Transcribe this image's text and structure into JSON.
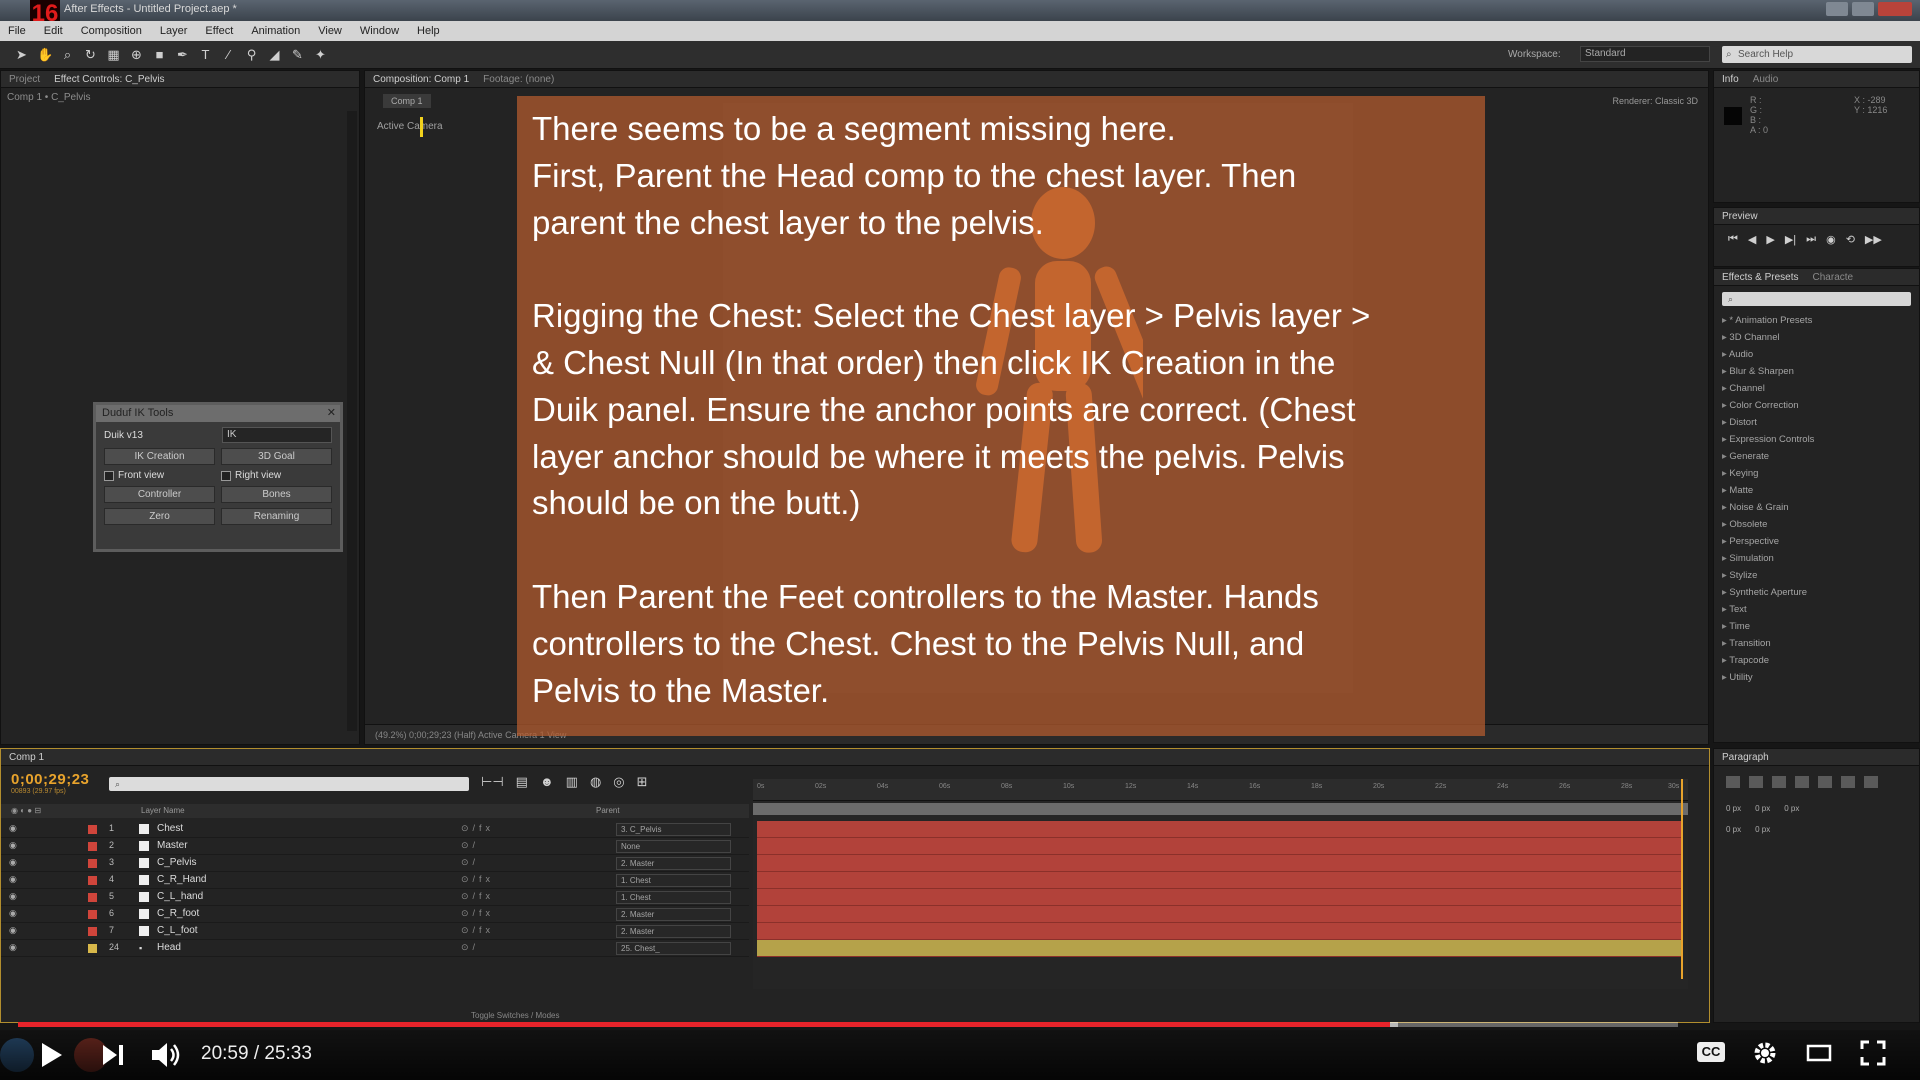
{
  "titlebar": {
    "badge": "16",
    "title": "After Effects - Untitled Project.aep *"
  },
  "menu": [
    "File",
    "Edit",
    "Composition",
    "Layer",
    "Effect",
    "Animation",
    "View",
    "Window",
    "Help"
  ],
  "toolbar": {
    "workspace_label": "Workspace:",
    "workspace_value": "Standard",
    "search_placeholder": "Search Help"
  },
  "left_panel": {
    "tabs": [
      "Project",
      "Effect Controls: C_Pelvis"
    ],
    "breadcrumb": "Comp 1 • C_Pelvis"
  },
  "duik": {
    "title": "Duduf IK Tools",
    "version": "Duik v13",
    "mode": "IK",
    "buttons": [
      "IK Creation",
      "3D Goal",
      "Controller",
      "Bones",
      "Zero",
      "Renaming"
    ],
    "front_view": "Front view",
    "right_view": "Right view"
  },
  "comp_panel": {
    "tabs": [
      "Composition: Comp 1",
      "Footage: (none)"
    ],
    "subtab": "Comp 1",
    "renderer": "Renderer:   Classic 3D",
    "active_camera": "Active Camera",
    "status": "(49.2%)        0;00;29;23                    (Half)              Active Camera        1 View"
  },
  "info_panel": {
    "tabs": [
      "Info",
      "Audio"
    ],
    "rgb": "R :\nG :\nB :\nA : 0",
    "xy": "X : -289\nY : 1216"
  },
  "preview_panel": {
    "tabs": [
      "Preview"
    ]
  },
  "effects_panel": {
    "tabs": [
      "Effects & Presets",
      "Characte"
    ],
    "items": [
      "* Animation Presets",
      "3D Channel",
      "Audio",
      "Blur & Sharpen",
      "Channel",
      "Color Correction",
      "Distort",
      "Expression Controls",
      "Generate",
      "Keying",
      "Matte",
      "Noise & Grain",
      "Obsolete",
      "Perspective",
      "Simulation",
      "Stylize",
      "Synthetic Aperture",
      "Text",
      "Time",
      "Transition",
      "Trapcode",
      "Utility"
    ]
  },
  "para_panel": {
    "tabs": [
      "Paragraph"
    ],
    "indent": [
      "0 px",
      "0 px",
      "0 px",
      "0 px",
      "0 px"
    ]
  },
  "timeline": {
    "tab": "Comp 1",
    "timecode": "0;00;29;23",
    "fps": "00893 (29.97 fps)",
    "columns": {
      "layer": "Layer Name",
      "parent": "Parent"
    },
    "ruler": [
      "0s",
      "02s",
      "04s",
      "06s",
      "08s",
      "10s",
      "12s",
      "14s",
      "16s",
      "18s",
      "20s",
      "22s",
      "24s",
      "26s",
      "28s",
      "30s"
    ],
    "layers": [
      {
        "num": "1",
        "name": "Chest",
        "parent": "3. C_Pelvis",
        "color": "#d0453b"
      },
      {
        "num": "2",
        "name": "Master",
        "parent": "None",
        "color": "#d0453b"
      },
      {
        "num": "3",
        "name": "C_Pelvis",
        "parent": "2. Master",
        "color": "#d0453b"
      },
      {
        "num": "4",
        "name": "C_R_Hand",
        "parent": "1. Chest",
        "color": "#d0453b"
      },
      {
        "num": "5",
        "name": "C_L_hand",
        "parent": "1. Chest",
        "color": "#d0453b"
      },
      {
        "num": "6",
        "name": "C_R_foot",
        "parent": "2. Master",
        "color": "#d0453b"
      },
      {
        "num": "7",
        "name": "C_L_foot",
        "parent": "2. Master",
        "color": "#d0453b"
      },
      {
        "num": "24",
        "name": "Head",
        "parent": "25. Chest_",
        "color": "#d8b84a"
      }
    ],
    "bottom": "Toggle Switches / Modes"
  },
  "annotation": {
    "lines": [
      "There seems to be a segment missing here.",
      "First, Parent the Head comp to the chest layer. Then",
      "parent the chest layer to the pelvis.",
      "",
      "Rigging the Chest: Select the Chest layer > Pelvis layer >",
      "& Chest Null (In that order) then click IK Creation in the",
      "Duik panel. Ensure the anchor points are correct. (Chest",
      "layer anchor should be where it meets the pelvis. Pelvis",
      "should be on the butt.)",
      "",
      "Then Parent the Feet controllers to the Master. Hands",
      "controllers to the Chest. Chest to the Pelvis Null, and",
      "Pelvis to the Master."
    ]
  },
  "player": {
    "time": "20:59 / 25:33",
    "cc": "CC",
    "played_fraction": 0.8263,
    "loaded_fraction": 0.8316,
    "colors": {
      "progress": "#e8242b"
    }
  }
}
